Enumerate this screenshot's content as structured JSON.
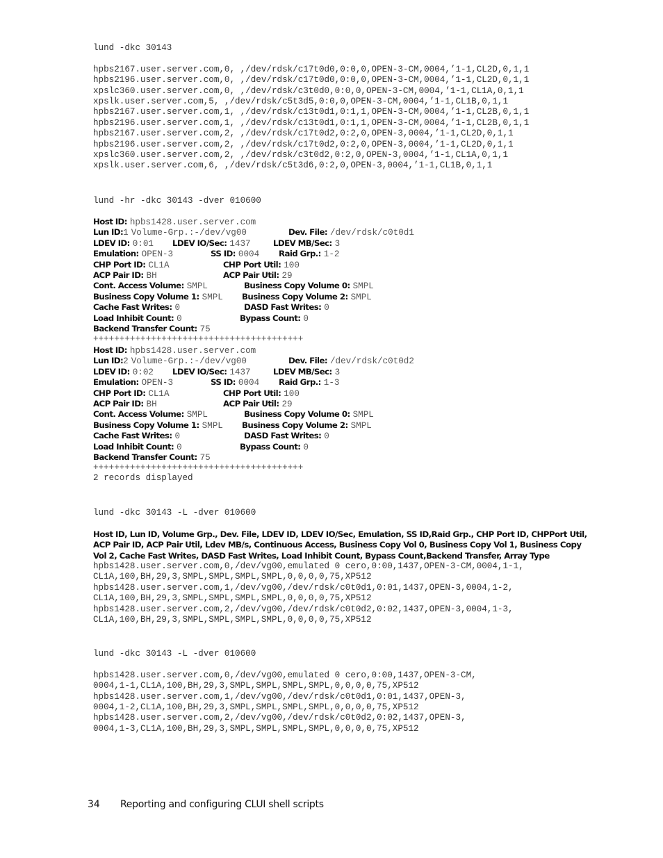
{
  "section1": {
    "command": "lund -dkc 30143",
    "lines": [
      "hpbs2167.user.server.com,0, ,/dev/rdsk/c17t0d0,0:0,0,OPEN-3-CM,0004,’1-1,CL2D,0,1,1",
      "hpbs2196.user.server.com,0, ,/dev/rdsk/c17t0d0,0:0,0,OPEN-3-CM,0004,’1-1,CL2D,0,1,1",
      "xpslc360.user.server.com,0, ,/dev/rdsk/c3t0d0,0:0,0,OPEN-3-CM,0004,’1-1,CL1A,0,1,1",
      "xpslk.user.server.com,5, ,/dev/rdsk/c5t3d5,0:0,0,OPEN-3-CM,0004,’1-1,CL1B,0,1,1",
      "hpbs2167.user.server.com,1, ,/dev/rdsk/c13t0d1,0:1,1,OPEN-3-CM,0004,’1-1,CL2B,0,1,1",
      "hpbs2196.user.server.com,1, ,/dev/rdsk/c13t0d1,0:1,1,OPEN-3-CM,0004,’1-1,CL2B,0,1,1",
      "hpbs2167.user.server.com,2, ,/dev/rdsk/c17t0d2,0:2,0,OPEN-3,0004,’1-1,CL2D,0,1,1",
      "hpbs2196.user.server.com,2, ,/dev/rdsk/c17t0d2,0:2,0,OPEN-3,0004,’1-1,CL2D,0,1,1",
      "xpslc360.user.server.com,2, ,/dev/rdsk/c3t0d2,0:2,0,OPEN-3,0004,’1-1,CL1A,0,1,1",
      "xpslk.user.server.com,6, ,/dev/rdsk/c5t3d6,0:2,0,OPEN-3,0004,’1-1,CL1B,0,1,1"
    ]
  },
  "section2": {
    "command": "lund -hr -dkc 30143 -dver 010600",
    "labels": {
      "host_id": "Host ID",
      "lun_id": "Lun ID",
      "volume_grp": "Volume-Grp.:",
      "dev_file": "Dev. File",
      "ldev_id": "LDEV ID",
      "ldev_io": "LDEV IO/Sec",
      "ldev_mb": "LDEV MB/Sec",
      "emulation": "Emulation",
      "ss_id": "SS ID",
      "raid_grp": "Raid Grp.",
      "chp_port_id": "CHP Port ID",
      "chp_port_util": "CHP Port Util",
      "acp_pair_id": "ACP Pair ID",
      "acp_pair_util": "ACP Pair Util",
      "cont_access": "Cont. Access Volume",
      "bc0": "Business Copy Volume 0",
      "bc1": "Business Copy Volume 1",
      "bc2": "Business Copy Volume 2",
      "cache_fast": "Cache Fast Writes",
      "dasd_fast": "DASD Fast Writes",
      "load_inhibit": "Load Inhibit Count",
      "bypass": "Bypass Count",
      "backend": "Backend Transfer Count",
      "colon": ":"
    },
    "records": [
      {
        "host_id": "hpbs1428.user.server.com",
        "lun_id": "1",
        "volume_grp": "-/dev/vg00",
        "dev_file": "/dev/rdsk/c0t0d1",
        "ldev_id": "0:01",
        "ldev_io": "1437",
        "ldev_mb": "3",
        "emulation": "OPEN-3",
        "ss_id": "0004",
        "raid_grp": "1-2",
        "chp_port_id": "CL1A",
        "chp_port_util": "100",
        "acp_pair_id": "BH",
        "acp_pair_util": "29",
        "cont_access": "SMPL",
        "bc0": "SMPL",
        "bc1": "SMPL",
        "bc2": "SMPL",
        "cache_fast": "0",
        "dasd_fast": "0",
        "load_inhibit": "0",
        "bypass": "0",
        "backend": "75"
      },
      {
        "host_id": "hpbs1428.user.server.com",
        "lun_id": "2",
        "volume_grp": "-/dev/vg00",
        "dev_file": "/dev/rdsk/c0t0d2",
        "ldev_id": "0:02",
        "ldev_io": "1437",
        "ldev_mb": "3",
        "emulation": "OPEN-3",
        "ss_id": "0004",
        "raid_grp": "1-3",
        "chp_port_id": "CL1A",
        "chp_port_util": "100",
        "acp_pair_id": "BH",
        "acp_pair_util": "29",
        "cont_access": "SMPL",
        "bc0": "SMPL",
        "bc1": "SMPL",
        "bc2": "SMPL",
        "cache_fast": "0",
        "dasd_fast": "0",
        "load_inhibit": "0",
        "bypass": "0",
        "backend": "75"
      }
    ],
    "separator": "++++++++++++++++++++++++++++++++++++++++",
    "summary": "2 records displayed"
  },
  "section3": {
    "command": "lund -dkc 30143 -L -dver 010600",
    "header": "Host ID, Lun ID, Volume Grp., Dev. File, LDEV ID, LDEV IO/Sec, Emulation, SS ID,Raid Grp., CHP Port ID, CHPPort Util, ACP Pair ID, ACP Pair Util, Ldev MB/s, Continuous Access, Business Copy Vol 0, Business Copy Vol 1, Business Copy Vol 2, Cache Fast Writes, DASD Fast Writes, Load Inhibit Count, Bypass Count,Backend Transfer, Array Type",
    "lines": [
      "hpbs1428.user.server.com,0,/dev/vg00,emulated 0 cero,0:00,1437,OPEN-3-CM,0004,1-1,",
      "CL1A,100,BH,29,3,SMPL,SMPL,SMPL,SMPL,0,0,0,0,75,XP512",
      "hpbs1428.user.server.com,1,/dev/vg00,/dev/rdsk/c0t0d1,0:01,1437,OPEN-3,0004,1-2,",
      "CL1A,100,BH,29,3,SMPL,SMPL,SMPL,SMPL,0,0,0,0,75,XP512",
      "hpbs1428.user.server.com,2,/dev/vg00,/dev/rdsk/c0t0d2,0:02,1437,OPEN-3,0004,1-3,",
      "CL1A,100,BH,29,3,SMPL,SMPL,SMPL,SMPL,0,0,0,0,75,XP512"
    ]
  },
  "section4": {
    "command": "lund -dkc 30143 -L -dver 010600",
    "lines": [
      "hpbs1428.user.server.com,0,/dev/vg00,emulated 0 cero,0:00,1437,OPEN-3-CM,",
      "0004,1-1,CL1A,100,BH,29,3,SMPL,SMPL,SMPL,SMPL,0,0,0,0,75,XP512",
      "hpbs1428.user.server.com,1,/dev/vg00,/dev/rdsk/c0t0d1,0:01,1437,OPEN-3,",
      "0004,1-2,CL1A,100,BH,29,3,SMPL,SMPL,SMPL,SMPL,0,0,0,0,75,XP512",
      "hpbs1428.user.server.com,2,/dev/vg00,/dev/rdsk/c0t0d2,0:02,1437,OPEN-3,",
      "0004,1-3,CL1A,100,BH,29,3,SMPL,SMPL,SMPL,SMPL,0,0,0,0,75,XP512"
    ]
  },
  "footer": {
    "page_number": "34",
    "title": "Reporting and configuring CLUI shell scripts"
  }
}
